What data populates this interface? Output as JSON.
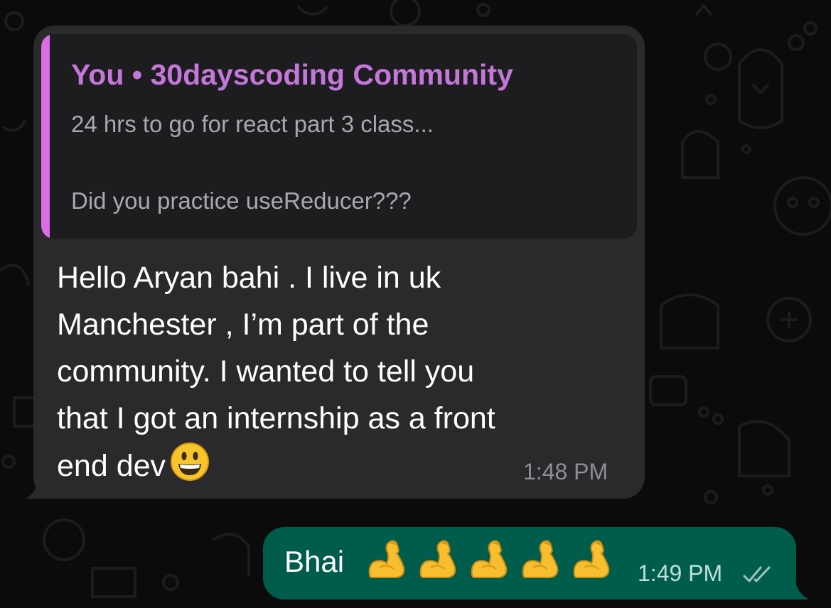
{
  "colors": {
    "background": "#0b0b0b",
    "incoming_bubble": "#2a2a2c",
    "quote_background": "#1d1d1f",
    "quote_accent": "#d96ee6",
    "quote_author": "#c377d9",
    "outgoing_bubble": "#005c4b"
  },
  "incoming": {
    "quote": {
      "author": "You • 30dayscoding Community",
      "text": "24 hrs to go for react part 3 class...\n\nDid you practice useReducer???"
    },
    "text": "Hello Aryan bahi . I live in uk\nManchester , I’m part of the\ncommunity. I wanted to tell you\nthat I got an internship as a front\nend dev",
    "emoji": "grinning-face-emoji",
    "time": "1:48 PM"
  },
  "outgoing": {
    "text": "Bhai",
    "emoji": "flexed-biceps-emoji",
    "emoji_count": 5,
    "time": "1:49 PM",
    "status_icon": "double-check-read-icon"
  }
}
